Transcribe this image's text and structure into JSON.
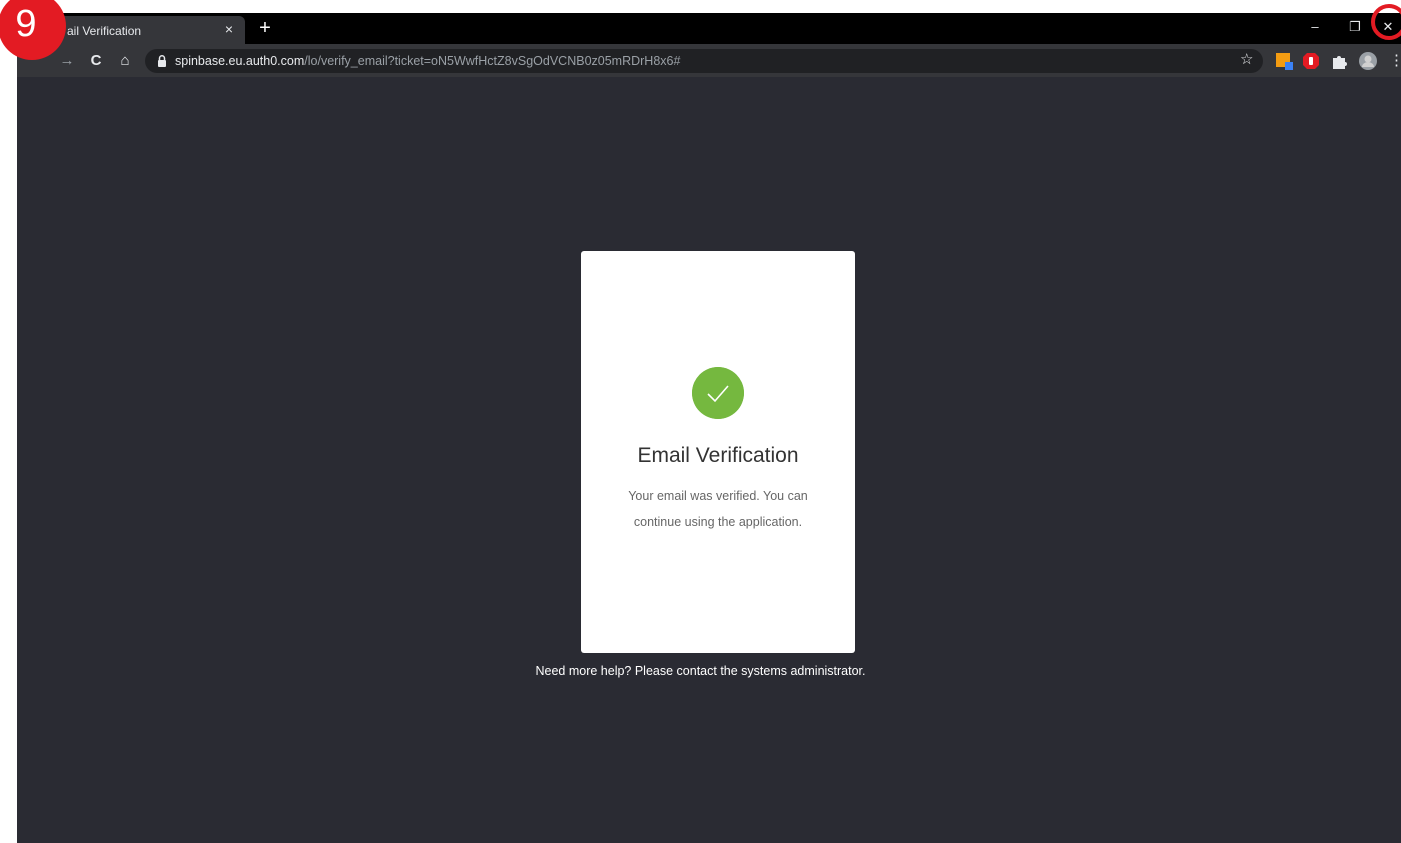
{
  "annotation": {
    "step_number": "9"
  },
  "browser": {
    "tab": {
      "title": "ail Verification",
      "close_glyph": "×"
    },
    "new_tab_glyph": "+",
    "window_controls": {
      "minimize_glyph": "–",
      "restore_glyph": "❐",
      "close_glyph": "✕"
    },
    "nav": {
      "forward_glyph": "→",
      "reload_glyph": "C",
      "home_glyph": "⌂"
    },
    "address": {
      "host": "spinbase.eu.auth0.com",
      "path": "/lo/verify_email?ticket=oN5WwfHctZ8vSgOdVCNB0z05mRDrH8x6#"
    },
    "bookmark_glyph": "☆",
    "extensions": [
      "extension-badge-icon",
      "adblock-icon",
      "puzzle-extensions-icon",
      "profile-avatar-icon"
    ]
  },
  "page": {
    "card": {
      "title": "Email Verification",
      "message": "Your email was verified. You can continue using the application."
    },
    "help_text": "Need more help? Please contact the systems administrator."
  },
  "colors": {
    "page_background": "#2a2b33",
    "success_green": "#75b83f",
    "annotation_red": "#e31b23"
  }
}
